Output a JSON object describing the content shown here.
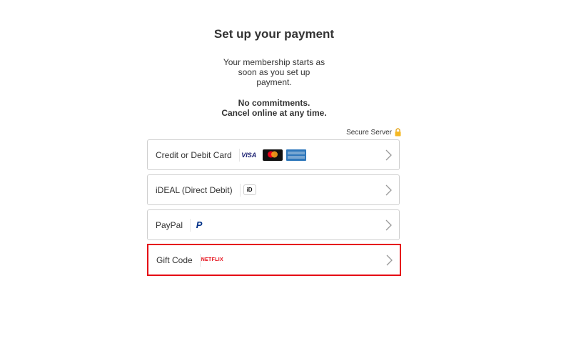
{
  "page": {
    "title": "Set up your payment",
    "subtitle": "Your membership starts as soon as you set up payment.",
    "commit_line1": "No commitments.",
    "commit_line2": "Cancel online at any time.",
    "secure_label": "Secure Server",
    "accent_color": "#e50914"
  },
  "options": [
    {
      "label": "Credit or Debit Card",
      "logos": [
        "visa-logo",
        "mastercard-logo",
        "amex-logo"
      ],
      "visa_text": "VISA"
    },
    {
      "label": "iDEAL (Direct Debit)",
      "logos": [
        "ideal-logo"
      ],
      "ideal_text": "iD"
    },
    {
      "label": "PayPal",
      "logos": [
        "paypal-logo"
      ],
      "paypal_text": "P"
    },
    {
      "label": "Gift Code",
      "logos": [
        "netflix-logo"
      ],
      "netflix_text": "NETFLIX",
      "highlighted": true
    }
  ]
}
